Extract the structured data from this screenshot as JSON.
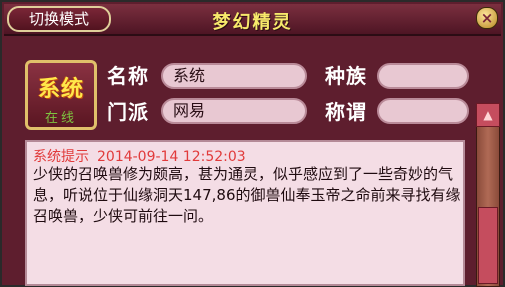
{
  "toolbar": {
    "mode_button": "切换模式",
    "close_symbol": "×"
  },
  "window": {
    "title": "梦幻精灵"
  },
  "avatar": {
    "name": "系统",
    "status": "在线"
  },
  "fields": {
    "name": {
      "label": "名称",
      "value": "系统"
    },
    "race": {
      "label": "种族",
      "value": ""
    },
    "sect": {
      "label": "门派",
      "value": "网易"
    },
    "title": {
      "label": "称谓",
      "value": ""
    }
  },
  "message": {
    "sender": "系统提示",
    "timestamp": "2014-09-14 12:52:03",
    "text": "少侠的召唤兽修为颇高，甚为通灵，似乎感应到了一些奇妙的气息，听说位于仙缘洞天147,86的御兽仙奉玉帝之命前来寻找有缘召唤兽，少侠可前往一问。"
  },
  "scrollbar": {
    "up_symbol": "▲"
  }
}
